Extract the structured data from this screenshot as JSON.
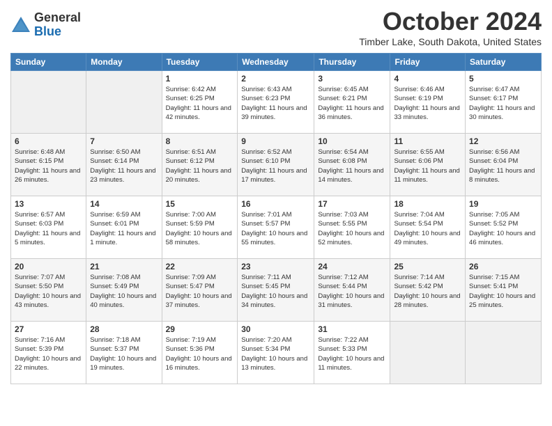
{
  "header": {
    "logo_general": "General",
    "logo_blue": "Blue",
    "month_title": "October 2024",
    "subtitle": "Timber Lake, South Dakota, United States"
  },
  "calendar": {
    "days_of_week": [
      "Sunday",
      "Monday",
      "Tuesday",
      "Wednesday",
      "Thursday",
      "Friday",
      "Saturday"
    ],
    "weeks": [
      [
        {
          "day": "",
          "info": ""
        },
        {
          "day": "",
          "info": ""
        },
        {
          "day": "1",
          "info": "Sunrise: 6:42 AM\nSunset: 6:25 PM\nDaylight: 11 hours and 42 minutes."
        },
        {
          "day": "2",
          "info": "Sunrise: 6:43 AM\nSunset: 6:23 PM\nDaylight: 11 hours and 39 minutes."
        },
        {
          "day": "3",
          "info": "Sunrise: 6:45 AM\nSunset: 6:21 PM\nDaylight: 11 hours and 36 minutes."
        },
        {
          "day": "4",
          "info": "Sunrise: 6:46 AM\nSunset: 6:19 PM\nDaylight: 11 hours and 33 minutes."
        },
        {
          "day": "5",
          "info": "Sunrise: 6:47 AM\nSunset: 6:17 PM\nDaylight: 11 hours and 30 minutes."
        }
      ],
      [
        {
          "day": "6",
          "info": "Sunrise: 6:48 AM\nSunset: 6:15 PM\nDaylight: 11 hours and 26 minutes."
        },
        {
          "day": "7",
          "info": "Sunrise: 6:50 AM\nSunset: 6:14 PM\nDaylight: 11 hours and 23 minutes."
        },
        {
          "day": "8",
          "info": "Sunrise: 6:51 AM\nSunset: 6:12 PM\nDaylight: 11 hours and 20 minutes."
        },
        {
          "day": "9",
          "info": "Sunrise: 6:52 AM\nSunset: 6:10 PM\nDaylight: 11 hours and 17 minutes."
        },
        {
          "day": "10",
          "info": "Sunrise: 6:54 AM\nSunset: 6:08 PM\nDaylight: 11 hours and 14 minutes."
        },
        {
          "day": "11",
          "info": "Sunrise: 6:55 AM\nSunset: 6:06 PM\nDaylight: 11 hours and 11 minutes."
        },
        {
          "day": "12",
          "info": "Sunrise: 6:56 AM\nSunset: 6:04 PM\nDaylight: 11 hours and 8 minutes."
        }
      ],
      [
        {
          "day": "13",
          "info": "Sunrise: 6:57 AM\nSunset: 6:03 PM\nDaylight: 11 hours and 5 minutes."
        },
        {
          "day": "14",
          "info": "Sunrise: 6:59 AM\nSunset: 6:01 PM\nDaylight: 11 hours and 1 minute."
        },
        {
          "day": "15",
          "info": "Sunrise: 7:00 AM\nSunset: 5:59 PM\nDaylight: 10 hours and 58 minutes."
        },
        {
          "day": "16",
          "info": "Sunrise: 7:01 AM\nSunset: 5:57 PM\nDaylight: 10 hours and 55 minutes."
        },
        {
          "day": "17",
          "info": "Sunrise: 7:03 AM\nSunset: 5:55 PM\nDaylight: 10 hours and 52 minutes."
        },
        {
          "day": "18",
          "info": "Sunrise: 7:04 AM\nSunset: 5:54 PM\nDaylight: 10 hours and 49 minutes."
        },
        {
          "day": "19",
          "info": "Sunrise: 7:05 AM\nSunset: 5:52 PM\nDaylight: 10 hours and 46 minutes."
        }
      ],
      [
        {
          "day": "20",
          "info": "Sunrise: 7:07 AM\nSunset: 5:50 PM\nDaylight: 10 hours and 43 minutes."
        },
        {
          "day": "21",
          "info": "Sunrise: 7:08 AM\nSunset: 5:49 PM\nDaylight: 10 hours and 40 minutes."
        },
        {
          "day": "22",
          "info": "Sunrise: 7:09 AM\nSunset: 5:47 PM\nDaylight: 10 hours and 37 minutes."
        },
        {
          "day": "23",
          "info": "Sunrise: 7:11 AM\nSunset: 5:45 PM\nDaylight: 10 hours and 34 minutes."
        },
        {
          "day": "24",
          "info": "Sunrise: 7:12 AM\nSunset: 5:44 PM\nDaylight: 10 hours and 31 minutes."
        },
        {
          "day": "25",
          "info": "Sunrise: 7:14 AM\nSunset: 5:42 PM\nDaylight: 10 hours and 28 minutes."
        },
        {
          "day": "26",
          "info": "Sunrise: 7:15 AM\nSunset: 5:41 PM\nDaylight: 10 hours and 25 minutes."
        }
      ],
      [
        {
          "day": "27",
          "info": "Sunrise: 7:16 AM\nSunset: 5:39 PM\nDaylight: 10 hours and 22 minutes."
        },
        {
          "day": "28",
          "info": "Sunrise: 7:18 AM\nSunset: 5:37 PM\nDaylight: 10 hours and 19 minutes."
        },
        {
          "day": "29",
          "info": "Sunrise: 7:19 AM\nSunset: 5:36 PM\nDaylight: 10 hours and 16 minutes."
        },
        {
          "day": "30",
          "info": "Sunrise: 7:20 AM\nSunset: 5:34 PM\nDaylight: 10 hours and 13 minutes."
        },
        {
          "day": "31",
          "info": "Sunrise: 7:22 AM\nSunset: 5:33 PM\nDaylight: 10 hours and 11 minutes."
        },
        {
          "day": "",
          "info": ""
        },
        {
          "day": "",
          "info": ""
        }
      ]
    ]
  }
}
